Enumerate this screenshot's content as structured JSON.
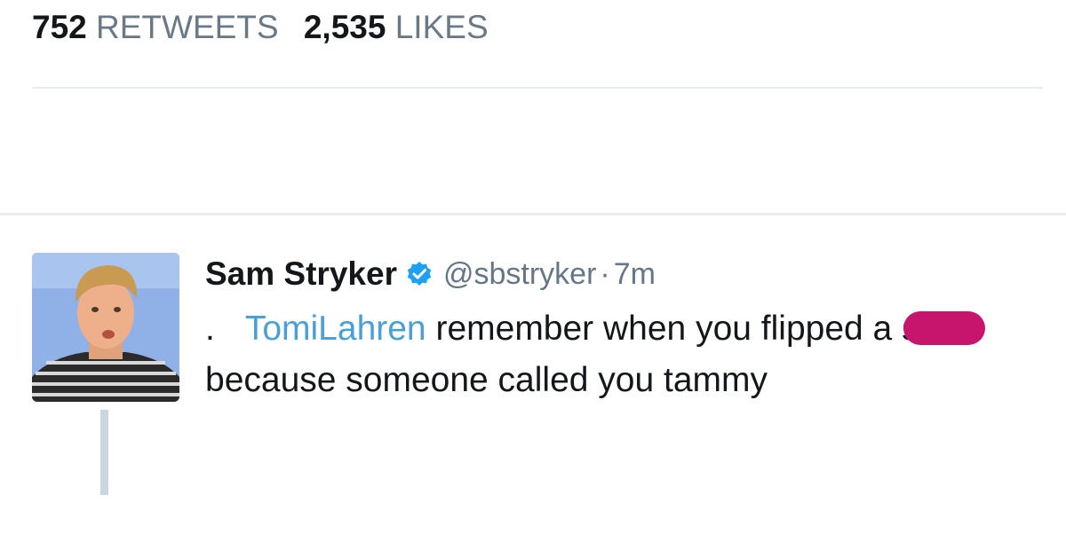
{
  "stats": {
    "retweets_count": "752",
    "retweets_label": "RETWEETS",
    "likes_count": "2,535",
    "likes_label": "LIKES"
  },
  "tweet": {
    "author_name": "Sam Stryker",
    "verified": true,
    "handle": "@sbstryker",
    "separator": "·",
    "time": "7m",
    "leading_char": ".",
    "mention": "TomiLahren",
    "text_part1": " remember when you flipped a s",
    "text_part2": "because someone called you tammy",
    "avatar_icon": "profile-photo"
  },
  "colors": {
    "mention": "#4a9fd8",
    "verified_badge": "#1da1f2",
    "redaction": "#c7146c",
    "muted_text": "#657786"
  }
}
